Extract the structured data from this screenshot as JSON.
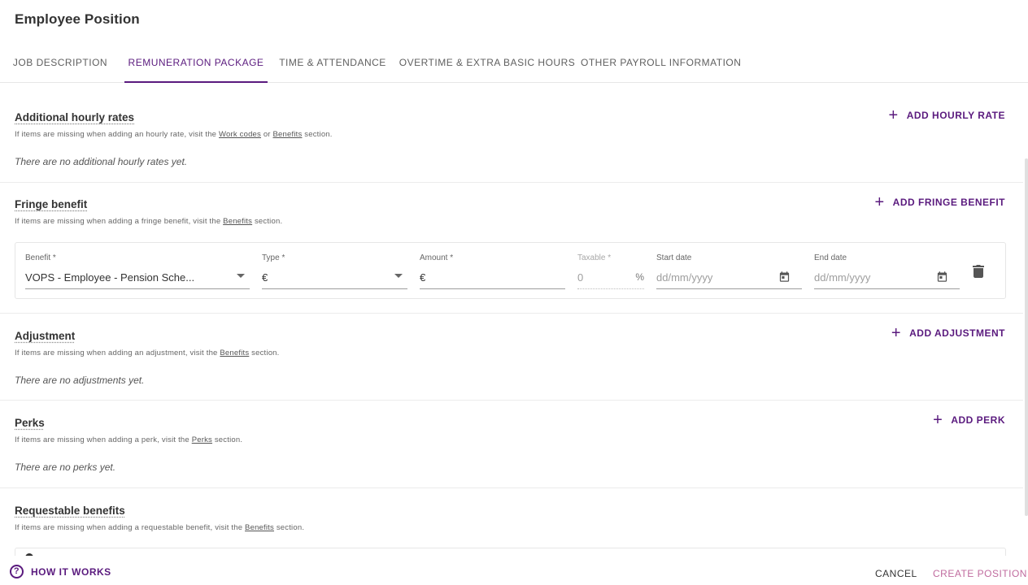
{
  "page": {
    "title": "Employee Position"
  },
  "tabs": [
    {
      "label": "JOB DESCRIPTION",
      "active": false
    },
    {
      "label": "REMUNERATION PACKAGE",
      "active": true
    },
    {
      "label": "TIME & ATTENDANCE",
      "active": false
    },
    {
      "label": "OVERTIME & EXTRA BASIC HOURS",
      "active": false
    },
    {
      "label": "OTHER PAYROLL INFORMATION",
      "active": false
    }
  ],
  "sections": {
    "hourly": {
      "title": "Additional hourly rates",
      "sub_prefix": "If items are missing when adding an hourly rate, visit the ",
      "link1": "Work codes",
      "sub_mid": " or ",
      "link2": "Benefits",
      "sub_suffix": " section.",
      "empty": "There are no additional hourly rates yet.",
      "add_label": "ADD HOURLY RATE"
    },
    "fringe": {
      "title": "Fringe benefit",
      "sub_prefix": "If items are missing when adding a fringe benefit, visit the ",
      "link1": "Benefits",
      "sub_suffix": " section.",
      "add_label": "ADD FRINGE BENEFIT",
      "row": {
        "benefit_label": "Benefit *",
        "benefit_value": "VOPS - Employee - Pension Sche...",
        "type_label": "Type *",
        "type_value": "€",
        "amount_label": "Amount *",
        "amount_value": "€",
        "taxable_label": "Taxable *",
        "taxable_value": "0",
        "taxable_unit": "%",
        "start_label": "Start date",
        "start_placeholder": "dd/mm/yyyy",
        "end_label": "End date",
        "end_placeholder": "dd/mm/yyyy"
      }
    },
    "adjustment": {
      "title": "Adjustment",
      "sub_prefix": "If items are missing when adding an adjustment, visit the ",
      "link1": "Benefits",
      "sub_suffix": " section.",
      "empty": "There are no adjustments yet.",
      "add_label": "ADD ADJUSTMENT"
    },
    "perks": {
      "title": "Perks",
      "sub_prefix": "If items are missing when adding a perk, visit the ",
      "link1": "Perks",
      "sub_suffix": " section.",
      "empty": "There are no perks yet.",
      "add_label": "ADD PERK"
    },
    "requestable": {
      "title": "Requestable benefits",
      "sub_prefix": "If items are missing when adding a requestable benefit, visit the ",
      "link1": "Benefits",
      "sub_suffix": " section."
    }
  },
  "footer": {
    "how_it_works": "HOW IT WORKS",
    "how_icon": "?",
    "cancel": "CANCEL",
    "create": "CREATE POSITION"
  },
  "colors": {
    "accent": "#5a1a7e",
    "create_disabled": "#c06b9e"
  },
  "icons": {
    "add": "plus-icon",
    "calendar": "calendar-icon",
    "delete": "trash-icon",
    "dropdown": "caret-down-icon",
    "help": "help-circle-icon"
  }
}
